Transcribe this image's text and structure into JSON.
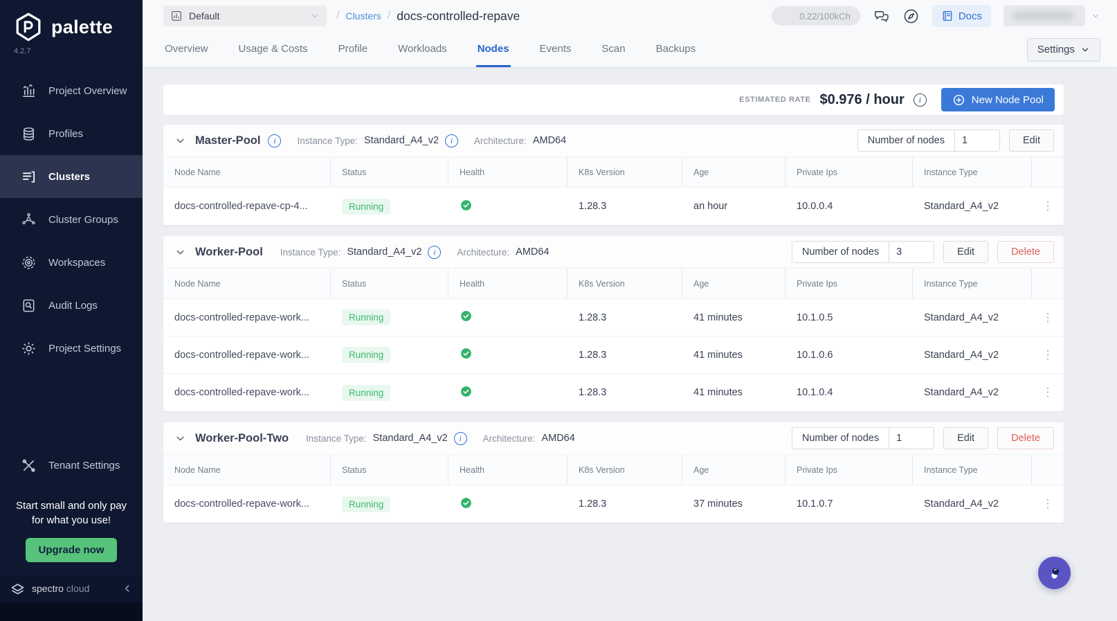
{
  "colors": {
    "accent_blue": "#2f6fd8",
    "status_green": "#3cb96f",
    "danger_red": "#df5f5c",
    "fab_purple": "#5a54c4",
    "sidebar_navy": "#0f1831",
    "upgrade_green": "#57c279"
  },
  "sidebar": {
    "logo_text": "palette",
    "logo_icon": "palette-hexagon-icon",
    "version": "4.2.7",
    "items": [
      {
        "label": "Project Overview",
        "icon": "project-overview",
        "active": false,
        "section": "top"
      },
      {
        "label": "Profiles",
        "icon": "profiles",
        "active": false,
        "section": "top"
      },
      {
        "label": "Clusters",
        "icon": "clusters",
        "active": true,
        "section": "top"
      },
      {
        "label": "Cluster Groups",
        "icon": "cluster-groups",
        "active": false,
        "section": "top"
      },
      {
        "label": "Workspaces",
        "icon": "workspaces",
        "active": false,
        "section": "top"
      },
      {
        "label": "Audit Logs",
        "icon": "audit-logs",
        "active": false,
        "section": "top"
      },
      {
        "label": "Project Settings",
        "icon": "project-settings",
        "active": false,
        "section": "top"
      },
      {
        "label": "Tenant Settings",
        "icon": "tenant-settings",
        "active": false,
        "section": "bottom"
      }
    ],
    "promo": {
      "line1": "Start small and only pay",
      "line2": "for what you use!",
      "button_label": "Upgrade now"
    },
    "footer": {
      "brand_word1": "spectro",
      "brand_word2": "cloud",
      "brand_icon": "spectro-logo-icon",
      "collapse_icon": "chevron-left-icon"
    }
  },
  "topbar": {
    "project_selector": {
      "label": "Default",
      "icon": "bar-chart-icon",
      "chevron": "chevron-down-icon"
    },
    "breadcrumb": {
      "slash": "/",
      "root": "Clusters",
      "current": "docs-controlled-repave"
    },
    "usage_pill": "0.22/100kCh",
    "right_icons": [
      "chat-icon",
      "compass-icon"
    ],
    "docs_button": {
      "label": "Docs",
      "icon": "book-icon"
    }
  },
  "tabs": {
    "items": [
      "Overview",
      "Usage & Costs",
      "Profile",
      "Workloads",
      "Nodes",
      "Events",
      "Scan",
      "Backups"
    ],
    "active": "Nodes",
    "settings_button": "Settings"
  },
  "rate_bar": {
    "label": "ESTIMATED RATE",
    "value": "$0.976 / hour",
    "info_icon": "info-icon",
    "new_pool_button": {
      "label": "New Node Pool",
      "icon": "plus-circle-icon"
    }
  },
  "table": {
    "columns": [
      "Node Name",
      "Status",
      "Health",
      "K8s Version",
      "Age",
      "Private Ips",
      "Instance Type"
    ]
  },
  "actions": {
    "edit": "Edit",
    "delete": "Delete"
  },
  "pools": [
    {
      "name": "Master-Pool",
      "has_info": true,
      "can_delete": false,
      "instance_type_label": "Instance Type:",
      "instance_type": "Standard_A4_v2",
      "architecture_label": "Architecture:",
      "architecture": "AMD64",
      "nodes_label": "Number of nodes",
      "nodes_count": "1",
      "rows": [
        {
          "name": "docs-controlled-repave-cp-4...",
          "status": "Running",
          "health": "healthy",
          "k8s_version": "1.28.3",
          "age": "an hour",
          "private_ip": "10.0.0.4",
          "instance_type": "Standard_A4_v2"
        }
      ]
    },
    {
      "name": "Worker-Pool",
      "has_info": false,
      "can_delete": true,
      "instance_type_label": "Instance Type:",
      "instance_type": "Standard_A4_v2",
      "architecture_label": "Architecture:",
      "architecture": "AMD64",
      "nodes_label": "Number of nodes",
      "nodes_count": "3",
      "rows": [
        {
          "name": "docs-controlled-repave-work...",
          "status": "Running",
          "health": "healthy",
          "k8s_version": "1.28.3",
          "age": "41 minutes",
          "private_ip": "10.1.0.5",
          "instance_type": "Standard_A4_v2"
        },
        {
          "name": "docs-controlled-repave-work...",
          "status": "Running",
          "health": "healthy",
          "k8s_version": "1.28.3",
          "age": "41 minutes",
          "private_ip": "10.1.0.6",
          "instance_type": "Standard_A4_v2"
        },
        {
          "name": "docs-controlled-repave-work...",
          "status": "Running",
          "health": "healthy",
          "k8s_version": "1.28.3",
          "age": "41 minutes",
          "private_ip": "10.1.0.4",
          "instance_type": "Standard_A4_v2"
        }
      ]
    },
    {
      "name": "Worker-Pool-Two",
      "has_info": false,
      "can_delete": true,
      "instance_type_label": "Instance Type:",
      "instance_type": "Standard_A4_v2",
      "architecture_label": "Architecture:",
      "architecture": "AMD64",
      "nodes_label": "Number of nodes",
      "nodes_count": "1",
      "rows": [
        {
          "name": "docs-controlled-repave-work...",
          "status": "Running",
          "health": "healthy",
          "k8s_version": "1.28.3",
          "age": "37 minutes",
          "private_ip": "10.1.0.7",
          "instance_type": "Standard_A4_v2"
        }
      ]
    }
  ],
  "fab": {
    "icon": "astronaut-icon"
  }
}
